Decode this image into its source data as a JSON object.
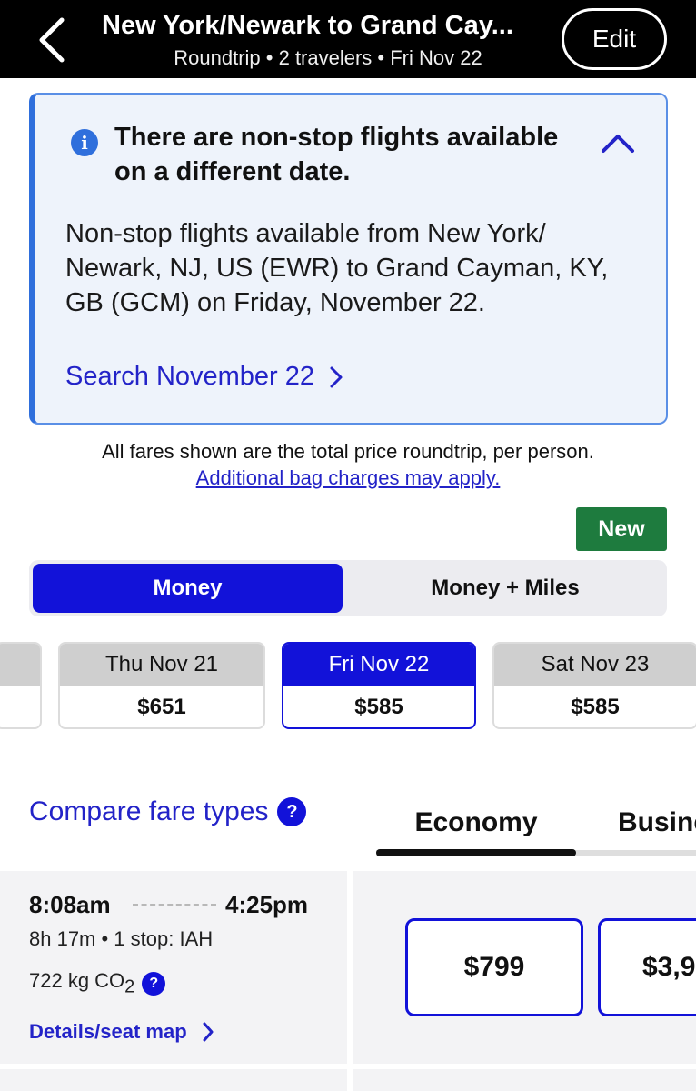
{
  "header": {
    "title": "New York/Newark to Grand Cay...",
    "subtitle": "Roundtrip • 2 travelers • Fri Nov 22",
    "edit_label": "Edit"
  },
  "info": {
    "title": "There are non-stop flights available on a different date.",
    "body": "Non-stop flights available from New York/ Newark, NJ, US (EWR) to Grand Cayman, KY, GB (GCM) on Friday, November 22.",
    "link": "Search November 22",
    "icon": "i"
  },
  "fares_note": "All fares shown are the total price roundtrip, per person.",
  "bag_link": "Additional bag charges may apply.",
  "new_badge": "New",
  "segmented": {
    "money": "Money",
    "money_miles": "Money + Miles"
  },
  "dates": [
    {
      "label": "Thu Nov 21",
      "price": "$651",
      "selected": false
    },
    {
      "label": "Fri Nov 22",
      "price": "$585",
      "selected": true
    },
    {
      "label": "Sat Nov 23",
      "price": "$585",
      "selected": false
    }
  ],
  "compare_label": "Compare fare types",
  "tabs": {
    "economy": "Economy",
    "business": "Business"
  },
  "flight": {
    "depart": "8:08am",
    "arrive": "4:25pm",
    "duration": "8h 17m • 1 stop: IAH",
    "co2": "722 kg CO",
    "co2_sub": "2",
    "details": "Details/seat map",
    "economy_price": "$799",
    "business_price": "$3,9"
  },
  "colors": {
    "brand_blue": "#1212d9",
    "link_blue": "#2323c8",
    "new_green": "#1e7b3e",
    "info_bg": "#eef3fb"
  }
}
